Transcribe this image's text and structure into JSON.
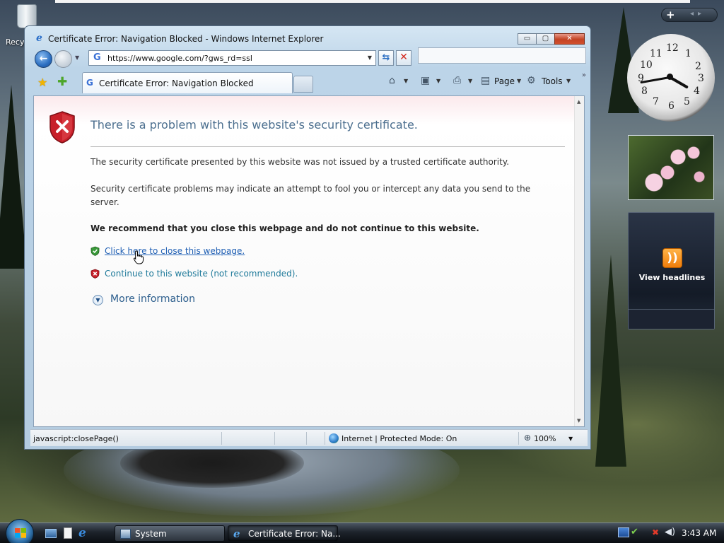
{
  "desktop": {
    "recycle_bin_label": "Recy"
  },
  "gadgets": {
    "clock_numbers": [
      "12",
      "1",
      "2",
      "3",
      "4",
      "5",
      "6",
      "7",
      "8",
      "9",
      "10",
      "11"
    ],
    "feed_label": "View headlines"
  },
  "window": {
    "title": "Certificate Error: Navigation Blocked - Windows Internet Explorer",
    "minimize_label": "▭",
    "maximize_label": "▢",
    "close_label": "✕"
  },
  "address_bar": {
    "url": "https://www.google.com/?gws_rd=ssl",
    "favicon_letter": "G"
  },
  "tab": {
    "favicon_letter": "G",
    "label": "Certificate Error: Navigation Blocked"
  },
  "command_bar": {
    "page_label": "Page",
    "tools_label": "Tools"
  },
  "content": {
    "heading": "There is a problem with this website's security certificate.",
    "para1": "The security certificate presented by this website was not issued by a trusted certificate authority.",
    "para2": "Security certificate problems may indicate an attempt to fool you or intercept any data you send to the server.",
    "recommendation": "We recommend that you close this webpage and do not continue to this website.",
    "close_link": "Click here to close this webpage.",
    "continue_link": "Continue to this website (not recommended).",
    "more_info": "More information"
  },
  "status_bar": {
    "status_text": "javascript:closePage()",
    "zone_text": "Internet | Protected Mode: On",
    "zoom_text": "100%"
  },
  "taskbar": {
    "tasks": [
      {
        "label": "System",
        "active": false
      },
      {
        "label": "Certificate Error: Na...",
        "active": true
      }
    ],
    "clock": "3:43 AM"
  },
  "colors": {
    "link": "#1f5fb4",
    "heading": "#4b6e8e",
    "shield_red": "#c8202a",
    "shield_green": "#3a9a3a"
  }
}
